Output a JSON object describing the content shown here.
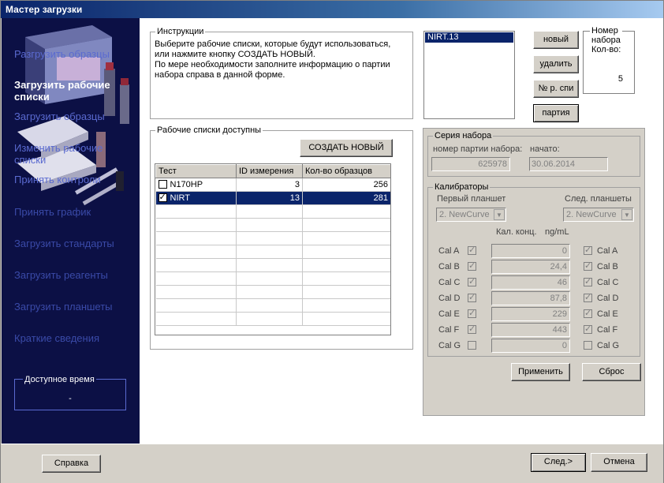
{
  "window": {
    "title": "Мастер загрузки"
  },
  "sidebar": {
    "items": [
      {
        "label": "Разгрузить образцы"
      },
      {
        "label": "Загрузить рабочие списки"
      },
      {
        "label": "Загрузить образцы"
      },
      {
        "label": "Изменить рабочие списки"
      },
      {
        "label": "Принять контроли"
      },
      {
        "label": "Принять график"
      },
      {
        "label": "Загрузить стандарты"
      },
      {
        "label": "Загрузить реагенты"
      },
      {
        "label": "Загрузить планшеты"
      },
      {
        "label": "Краткие сведения"
      }
    ],
    "time_box": {
      "title": "Доступное время",
      "value": "-"
    }
  },
  "instructions": {
    "title": "Инструкции",
    "text1": "Выберите рабочие списки, которые будут использоваться,",
    "text2": "или нажмите кнопку СОЗДАТЬ НОВЫЙ.",
    "text3": "По мере необходимости заполните информацию о партии",
    "text4": "набора справа в данной форме."
  },
  "worklists": {
    "title": "Рабочие списки доступны",
    "create_button": "СОЗДАТЬ НОВЫЙ",
    "columns": [
      "Тест",
      "ID измерения",
      "Кол-во образцов"
    ],
    "rows": [
      {
        "test": "N170HP",
        "id": "3",
        "count": "256",
        "checked": false,
        "selected": false
      },
      {
        "test": "NIRT",
        "id": "13",
        "count": "281",
        "checked": true,
        "selected": true
      }
    ]
  },
  "kit_list": {
    "items": [
      "NIRT.13"
    ]
  },
  "kit_buttons": {
    "new": "новый",
    "delete": "удалить",
    "serial": "№ р. спи",
    "lot": "партия"
  },
  "kit_info": {
    "title_line1": "Номер",
    "title_line2": "набора",
    "title_line3": "Кол-во:",
    "value": "5"
  },
  "series": {
    "title": "Серия набора",
    "lot_label": "номер партии набора:",
    "lot_value": "625978",
    "start_label": "начато:",
    "start_value": "30.06.2014"
  },
  "calibrators": {
    "title": "Калибраторы",
    "first_plate_label": "Первый планшет",
    "next_plates_label": "След. планшеты",
    "first_plate_value": "2. NewCurve",
    "next_plates_value": "2. NewCurve",
    "conc_label": "Кал. конц.",
    "unit_label": "ng/mL",
    "rows": [
      {
        "label": "Cal A",
        "value": "0",
        "left_checked": true,
        "right_checked": true
      },
      {
        "label": "Cal B",
        "value": "24,4",
        "left_checked": true,
        "right_checked": true
      },
      {
        "label": "Cal C",
        "value": "46",
        "left_checked": true,
        "right_checked": true
      },
      {
        "label": "Cal D",
        "value": "87,8",
        "left_checked": true,
        "right_checked": true
      },
      {
        "label": "Cal E",
        "value": "229",
        "left_checked": true,
        "right_checked": true
      },
      {
        "label": "Cal F",
        "value": "443",
        "left_checked": true,
        "right_checked": true
      },
      {
        "label": "Cal G",
        "value": "0",
        "left_checked": false,
        "right_checked": false
      }
    ],
    "apply_button": "Применить",
    "reset_button": "Сброс"
  },
  "footer": {
    "help_button": "Справка",
    "next_button": "След.>",
    "cancel_button": "Отмена"
  },
  "colors": {
    "title_bar": "#0a246a",
    "sidebar_bg": "#0c1045",
    "selection": "#0a246a",
    "window_bg": "#d4d0c8"
  },
  "icons": {
    "checkbox": "check-mark",
    "dropdown": "chevron-down-icon"
  }
}
